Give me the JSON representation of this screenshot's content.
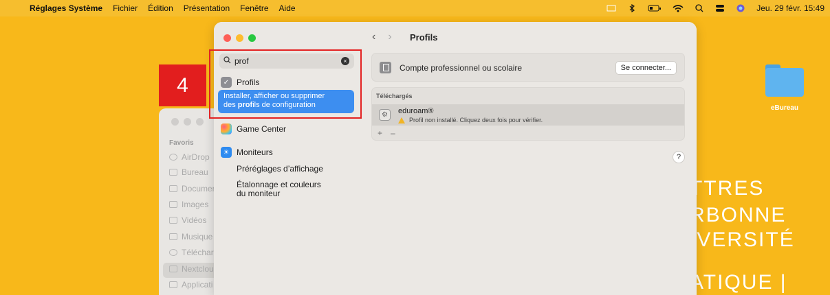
{
  "menubar": {
    "app_name": "Réglages Système",
    "menus": [
      "Fichier",
      "Édition",
      "Présentation",
      "Fenêtre",
      "Aide"
    ],
    "clock": "Jeu. 29 févr. 15:49"
  },
  "desktop": {
    "folder_label": "eBureau",
    "wallpaper_lines": [
      "TTRES",
      "RBONNE",
      "IVERSITÉ",
      "ATIQUE |"
    ]
  },
  "finder": {
    "favorites_header": "Favoris",
    "items": [
      "AirDrop",
      "Bureau",
      "Documer",
      "Images",
      "Vidéos",
      "Musique",
      "Téléchar",
      "Nextclou",
      "Applicati"
    ]
  },
  "sidebar": {
    "search_value": "prof",
    "results": {
      "profiles": "Profils",
      "profiles_sub_1": "Installer, afficher ou supprimer",
      "profiles_sub_2a": "des ",
      "profiles_sub_2b": "prof",
      "profiles_sub_2c": "ils de configuration",
      "game_center": "Game Center",
      "monitors": "Moniteurs",
      "monitors_sub1": "Préréglages d’affichage",
      "monitors_sub2a": "Étalonnage et couleurs",
      "monitors_sub2b": "du moniteur"
    }
  },
  "main": {
    "title": "Profils",
    "account_label": "Compte professionnel ou scolaire",
    "connect_button": "Se connecter...",
    "downloaded_header": "Téléchargés",
    "profile_name": "eduroam®",
    "profile_warning": "Profil non installé. Cliquez deux fois pour vérifier.",
    "add": "+",
    "remove": "–",
    "help": "?"
  },
  "overlay": {
    "step_number": "4"
  }
}
